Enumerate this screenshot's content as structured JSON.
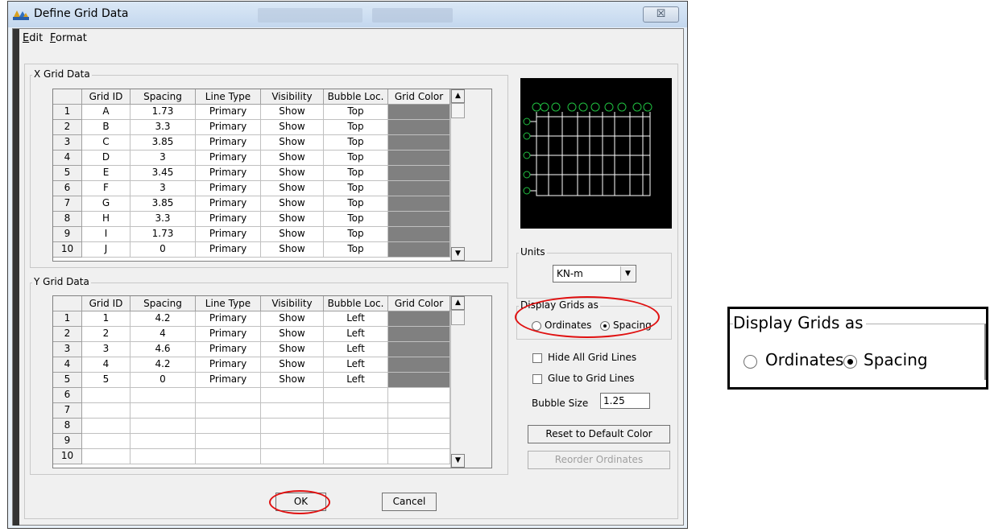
{
  "window": {
    "title": "Define Grid Data",
    "close_glyph": "☒"
  },
  "menu": [
    {
      "key": "E",
      "rest": "dit"
    },
    {
      "key": "F",
      "rest": "ormat"
    }
  ],
  "x_group": {
    "title": "X Grid Data"
  },
  "y_group": {
    "title": "Y Grid Data"
  },
  "columns": [
    "Grid ID",
    "Spacing",
    "Line Type",
    "Visibility",
    "Bubble Loc.",
    "Grid Color"
  ],
  "x_rows": [
    {
      "n": "1",
      "id": "A",
      "spacing": "1.73",
      "type": "Primary",
      "vis": "Show",
      "loc": "Top"
    },
    {
      "n": "2",
      "id": "B",
      "spacing": "3.3",
      "type": "Primary",
      "vis": "Show",
      "loc": "Top"
    },
    {
      "n": "3",
      "id": "C",
      "spacing": "3.85",
      "type": "Primary",
      "vis": "Show",
      "loc": "Top"
    },
    {
      "n": "4",
      "id": "D",
      "spacing": "3",
      "type": "Primary",
      "vis": "Show",
      "loc": "Top"
    },
    {
      "n": "5",
      "id": "E",
      "spacing": "3.45",
      "type": "Primary",
      "vis": "Show",
      "loc": "Top"
    },
    {
      "n": "6",
      "id": "F",
      "spacing": "3",
      "type": "Primary",
      "vis": "Show",
      "loc": "Top"
    },
    {
      "n": "7",
      "id": "G",
      "spacing": "3.85",
      "type": "Primary",
      "vis": "Show",
      "loc": "Top"
    },
    {
      "n": "8",
      "id": "H",
      "spacing": "3.3",
      "type": "Primary",
      "vis": "Show",
      "loc": "Top"
    },
    {
      "n": "9",
      "id": "I",
      "spacing": "1.73",
      "type": "Primary",
      "vis": "Show",
      "loc": "Top"
    },
    {
      "n": "10",
      "id": "J",
      "spacing": "0",
      "type": "Primary",
      "vis": "Show",
      "loc": "Top"
    }
  ],
  "y_rows": [
    {
      "n": "1",
      "id": "1",
      "spacing": "4.2",
      "type": "Primary",
      "vis": "Show",
      "loc": "Left"
    },
    {
      "n": "2",
      "id": "2",
      "spacing": "4",
      "type": "Primary",
      "vis": "Show",
      "loc": "Left"
    },
    {
      "n": "3",
      "id": "3",
      "spacing": "4.6",
      "type": "Primary",
      "vis": "Show",
      "loc": "Left"
    },
    {
      "n": "4",
      "id": "4",
      "spacing": "4.2",
      "type": "Primary",
      "vis": "Show",
      "loc": "Left"
    },
    {
      "n": "5",
      "id": "5",
      "spacing": "0",
      "type": "Primary",
      "vis": "Show",
      "loc": "Left"
    },
    {
      "n": "6",
      "id": "",
      "spacing": "",
      "type": "",
      "vis": "",
      "loc": ""
    },
    {
      "n": "7",
      "id": "",
      "spacing": "",
      "type": "",
      "vis": "",
      "loc": ""
    },
    {
      "n": "8",
      "id": "",
      "spacing": "",
      "type": "",
      "vis": "",
      "loc": ""
    },
    {
      "n": "9",
      "id": "",
      "spacing": "",
      "type": "",
      "vis": "",
      "loc": ""
    },
    {
      "n": "10",
      "id": "",
      "spacing": "",
      "type": "",
      "vis": "",
      "loc": ""
    }
  ],
  "grid_color_hex": "#808080",
  "units": {
    "title": "Units",
    "selected": "KN-m"
  },
  "display": {
    "title": "Display Grids as",
    "option1": "Ordinates",
    "option2": "Spacing",
    "selected": "Spacing"
  },
  "options": {
    "hide_lines": "Hide All Grid Lines",
    "glue": "Glue to Grid Lines",
    "hide_checked": false,
    "glue_checked": false
  },
  "bubble": {
    "label": "Bubble Size",
    "value": "1.25"
  },
  "buttons": {
    "reset": "Reset to Default Color",
    "reorder": "Reorder Ordinates",
    "ok": "OK",
    "cancel": "Cancel"
  },
  "annotation_color": "#e01010",
  "zoom_inset": {
    "title": "Display Grids as",
    "option1": "Ordinates",
    "option2": "Spacing"
  }
}
